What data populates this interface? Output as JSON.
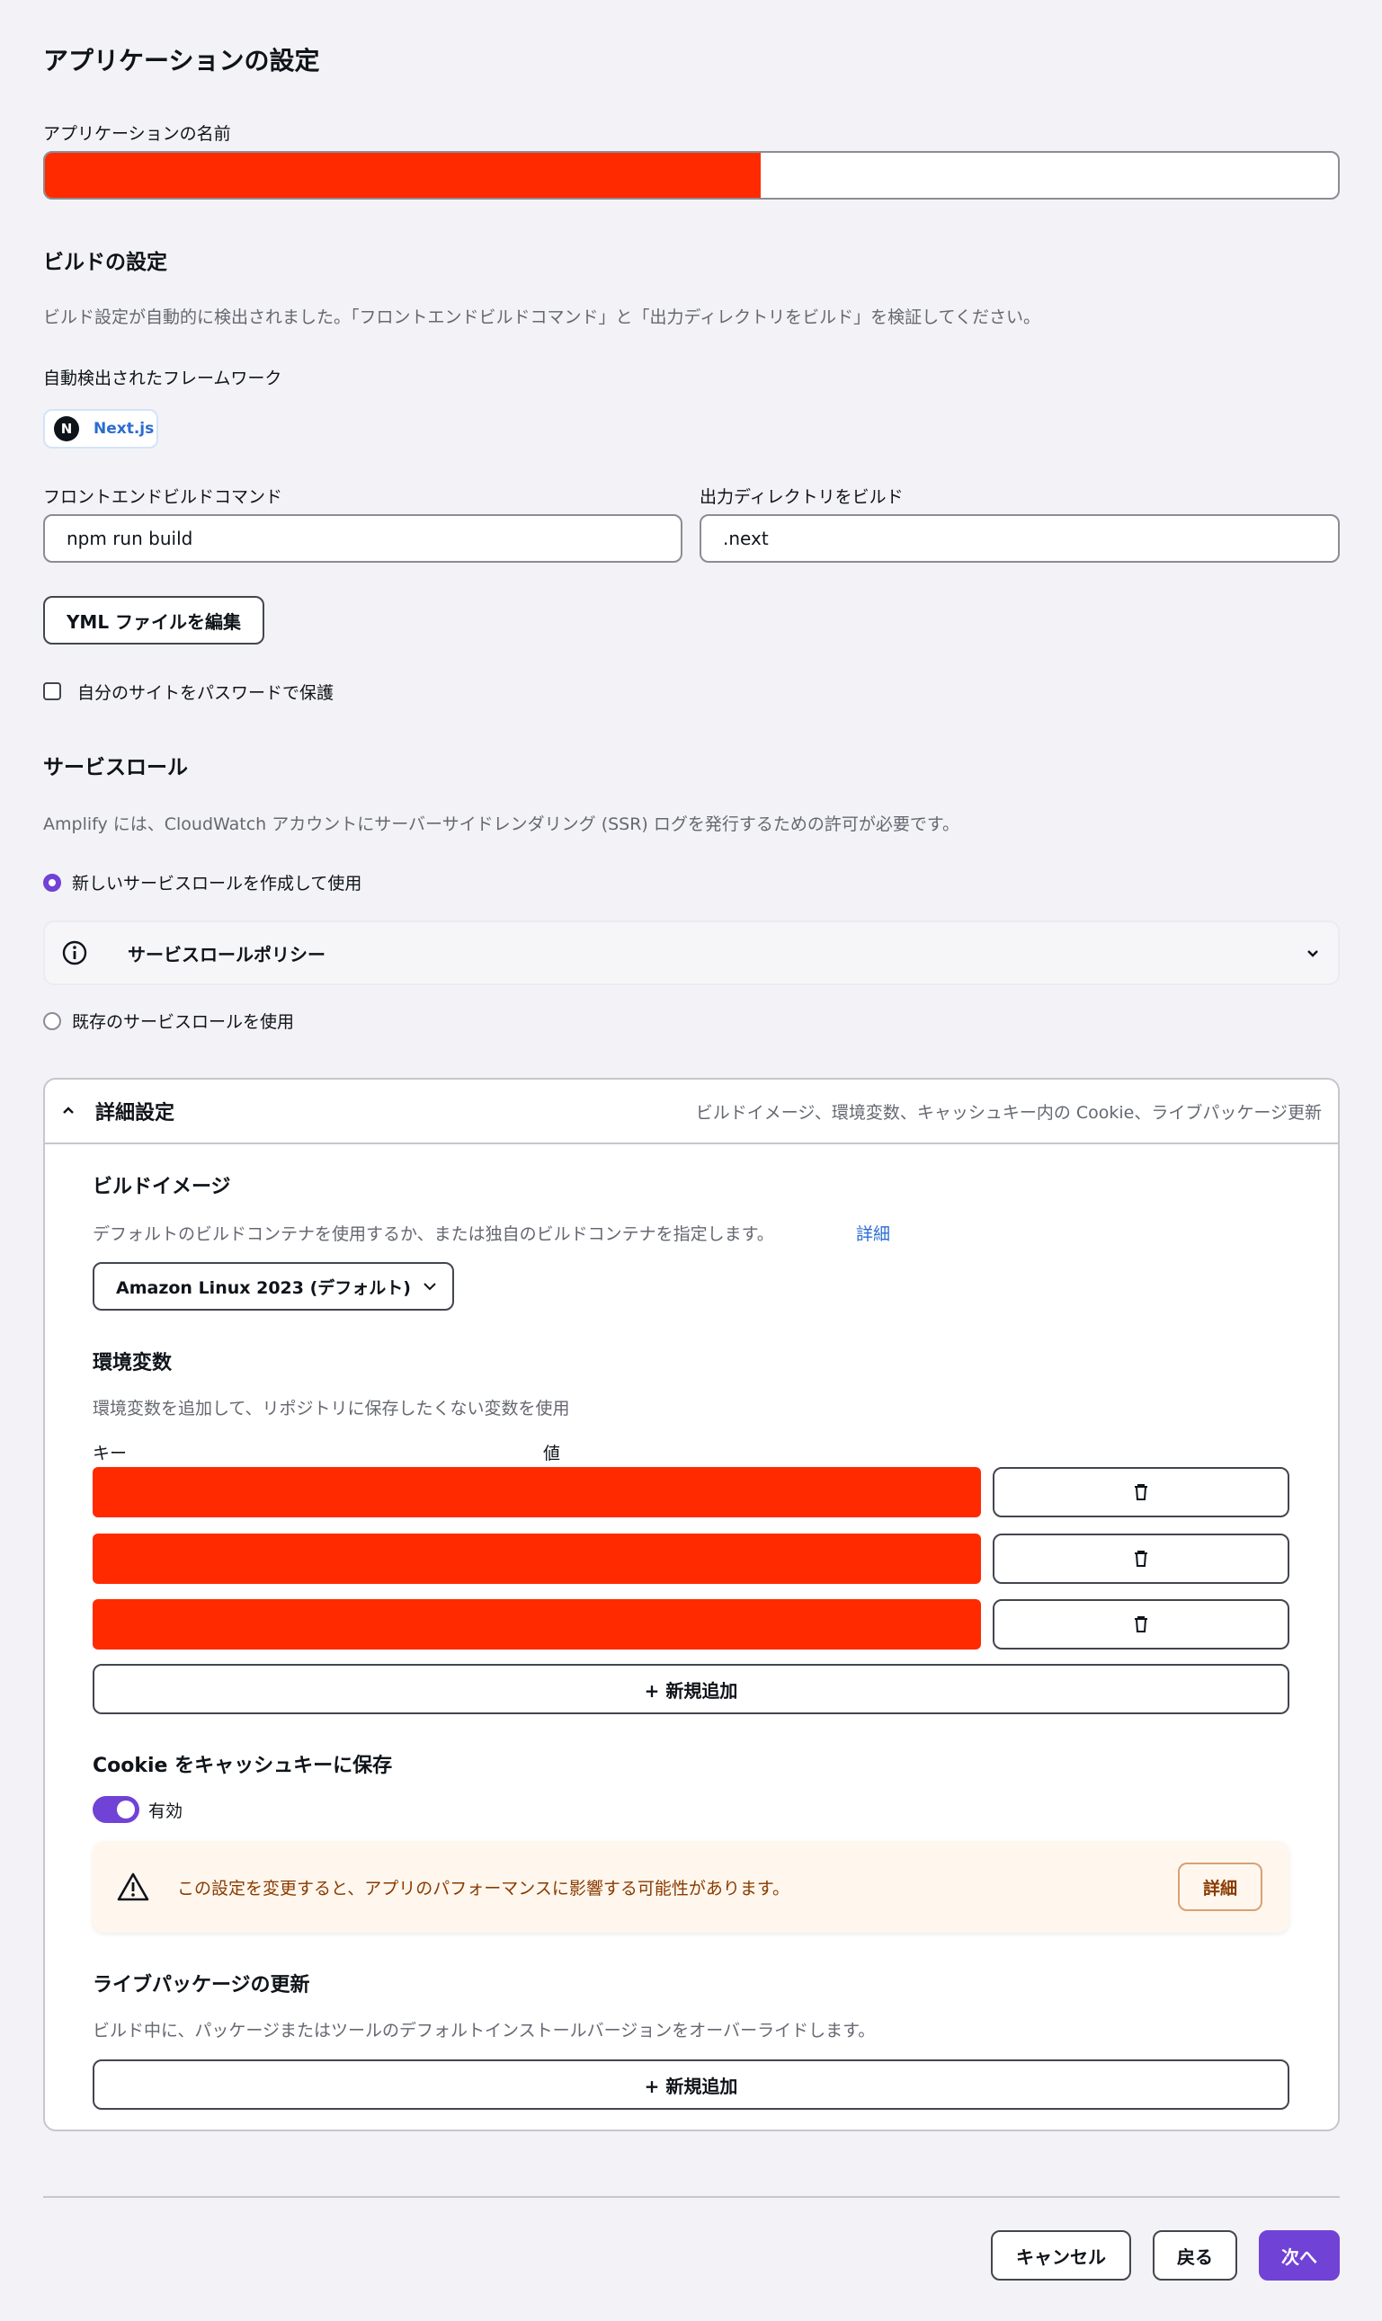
{
  "page": {
    "title": "アプリケーションの設定",
    "app_name_label": "アプリケーションの名前"
  },
  "build": {
    "title": "ビルドの設定",
    "description": "ビルド設定が自動的に検出されました。「フロントエンドビルドコマンド」と「出力ディレクトリをビルド」を検証してください。",
    "framework_label": "自動検出されたフレームワーク",
    "framework_name": "Next.js",
    "command_label": "フロントエンドビルドコマンド",
    "command_value": "npm run build",
    "output_label": "出力ディレクトリをビルド",
    "output_value": ".next",
    "yml_button": "YML ファイルを編集",
    "password_label": "自分のサイトをパスワードで保護"
  },
  "service_role": {
    "title": "サービスロール",
    "description": "Amplify には、CloudWatch アカウントにサーバーサイドレンダリング (SSR) ログを発行するための許可が必要です。",
    "option_new": "新しいサービスロールを作成して使用",
    "policy_title": "サービスロールポリシー",
    "option_existing": "既存のサービスロールを使用"
  },
  "advanced": {
    "title": "詳細設定",
    "summary": "ビルドイメージ、環境変数、キャッシュキー内の Cookie、ライブパッケージ更新",
    "build_image": {
      "title": "ビルドイメージ",
      "description": "デフォルトのビルドコンテナを使用するか、または独自のビルドコンテナを指定します。",
      "link": "詳細",
      "selected": "Amazon Linux 2023 (デフォルト)"
    },
    "env": {
      "title": "環境変数",
      "description": "環境変数を追加して、リポジトリに保存したくない変数を使用",
      "key_header": "キー",
      "value_header": "値",
      "add_button": "+ 新規追加"
    },
    "cookie": {
      "title": "Cookie をキャッシュキーに保存",
      "toggle_label": "有効",
      "warning_text": "この設定を変更すると、アプリのパフォーマンスに影響する可能性があります。",
      "warning_button": "詳細"
    },
    "live_packages": {
      "title": "ライブパッケージの更新",
      "description": "ビルド中に、パッケージまたはツールのデフォルトインストールバージョンをオーバーライドします。",
      "add_button": "+ 新規追加"
    }
  },
  "footer": {
    "cancel": "キャンセル",
    "back": "戻る",
    "next": "次へ"
  },
  "colors": {
    "accent": "#7142d6",
    "redaction": "#ff2a00",
    "warning_bg": "#fff7ee",
    "warning_text": "#8a3b00"
  }
}
